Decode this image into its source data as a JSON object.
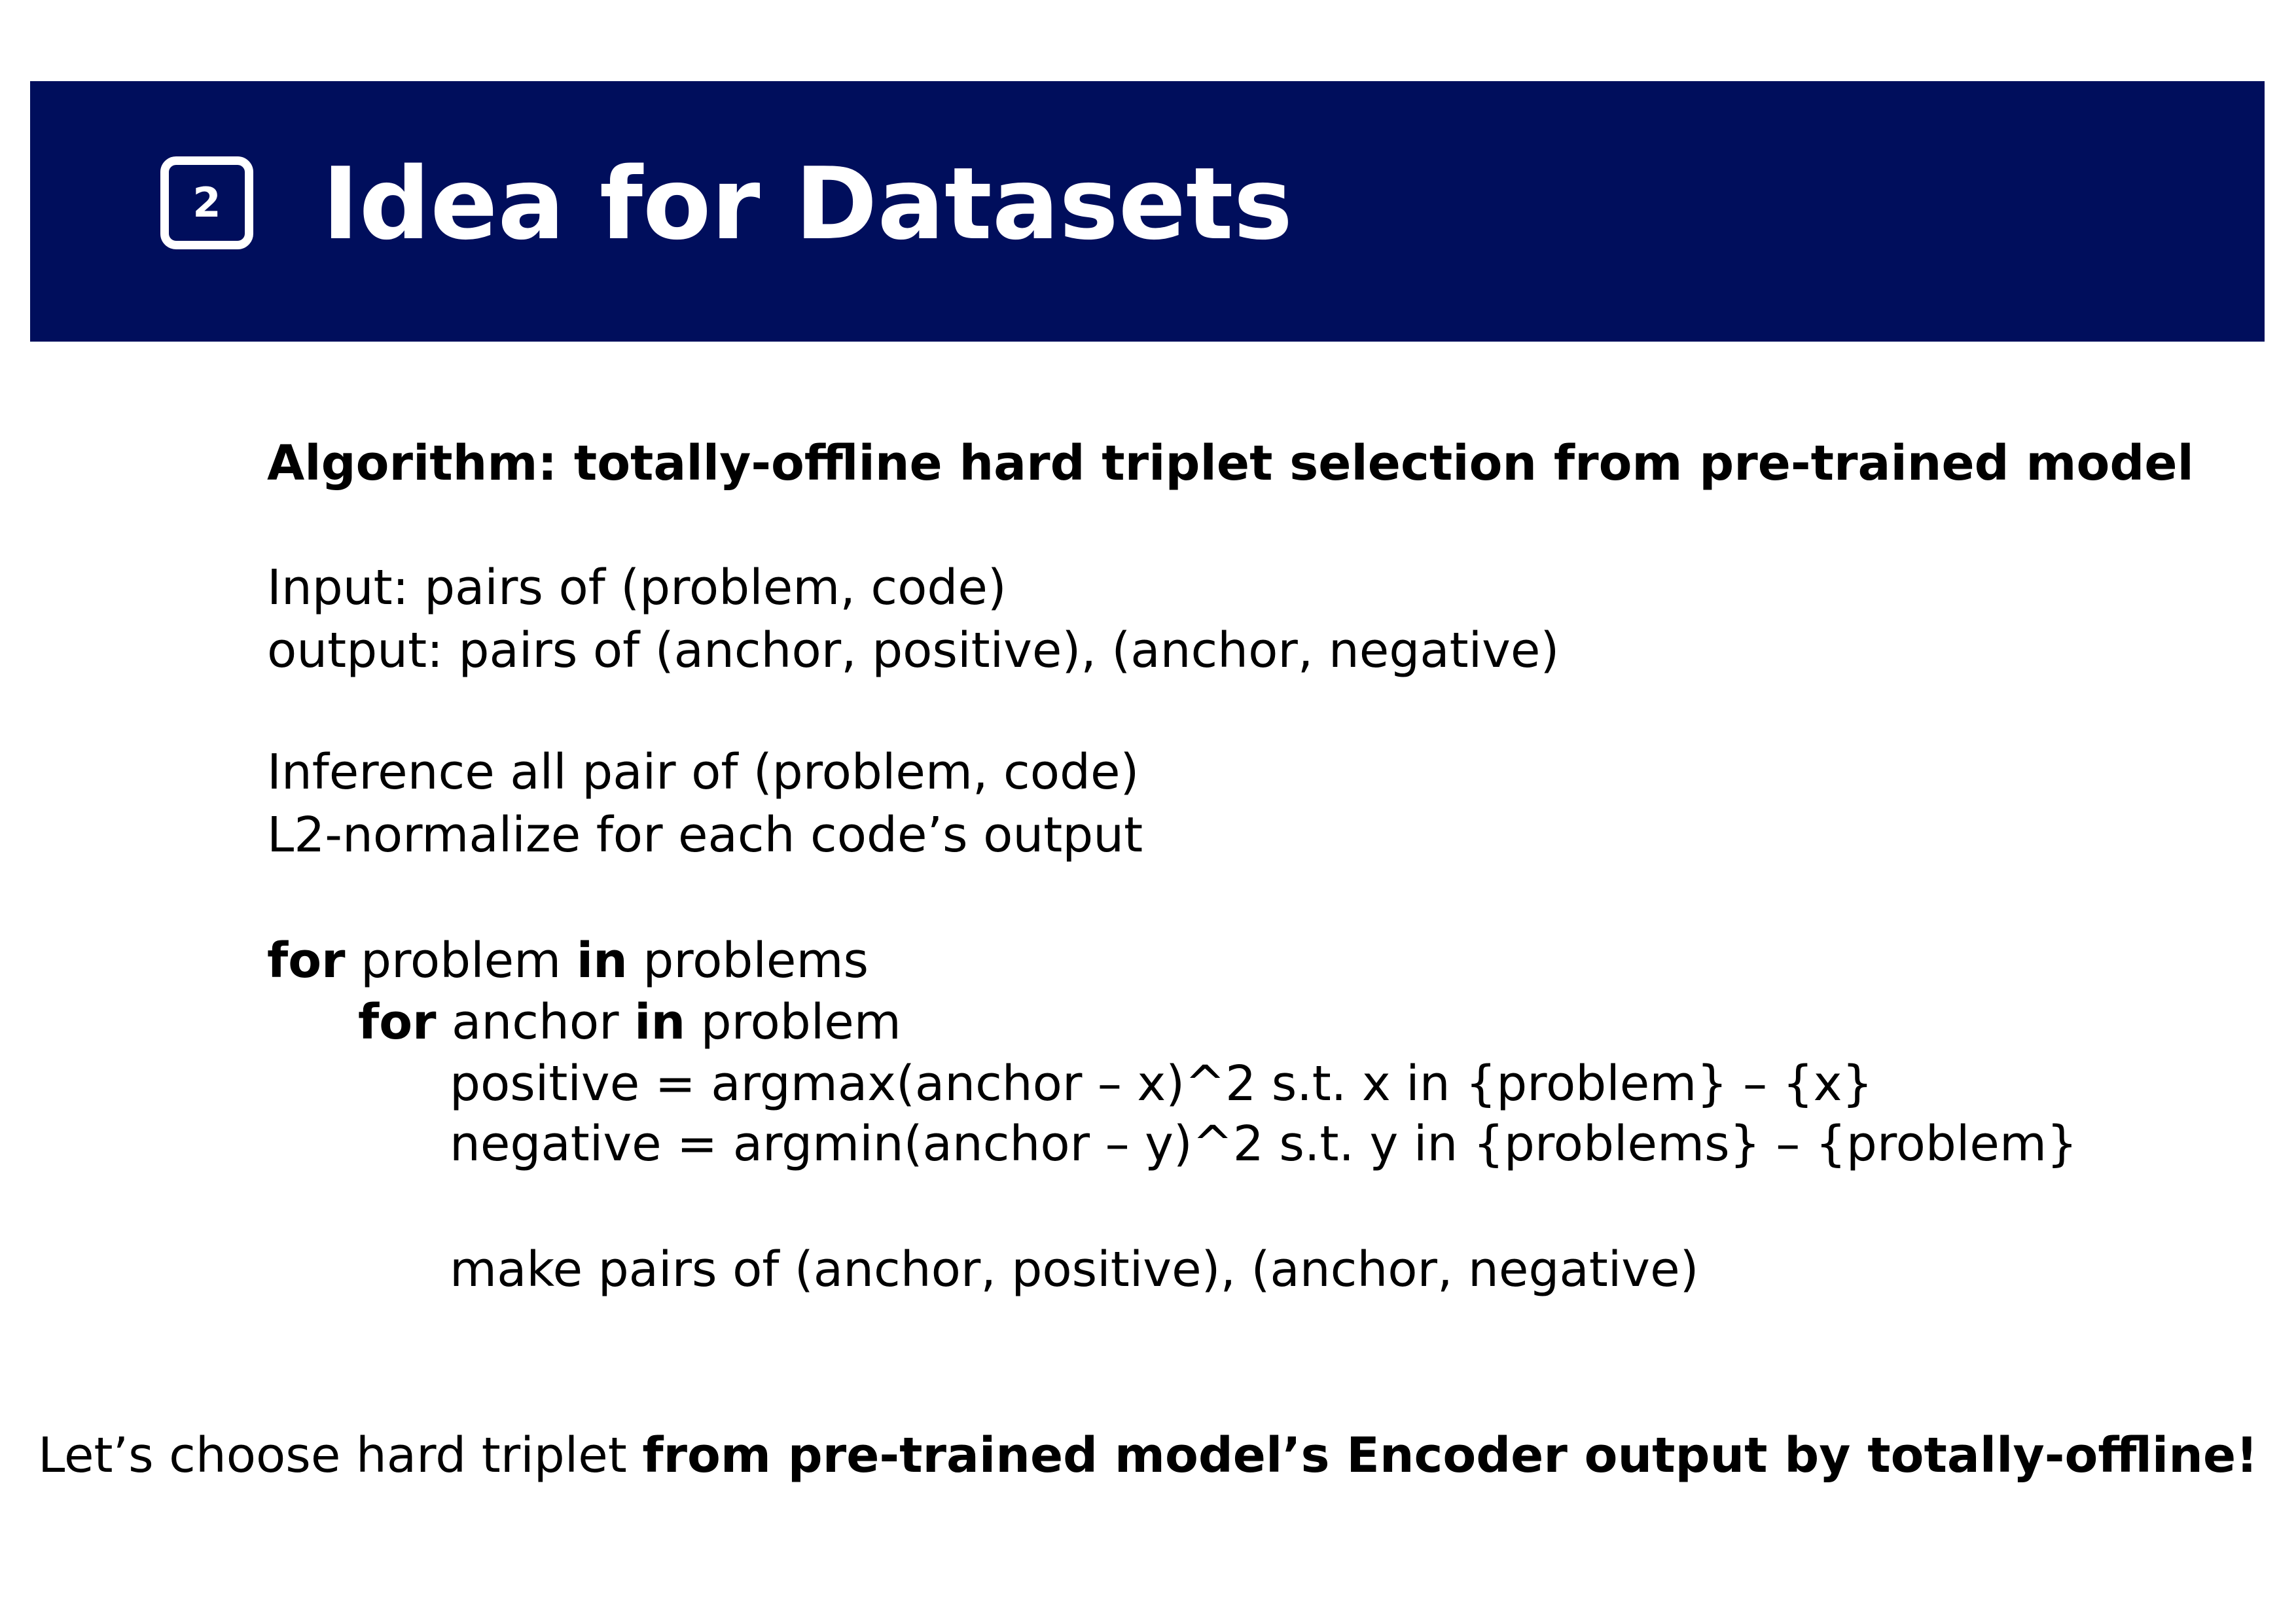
{
  "header": {
    "badge_number": "2",
    "title": "Idea for Datasets",
    "background_color": "#000e5c",
    "text_color": "#ffffff"
  },
  "algorithm": {
    "title": "Algorithm: totally-offline hard triplet selection from pre-trained model",
    "input": "Input: pairs of (problem, code)",
    "output": "output: pairs of (anchor, positive), (anchor, negative)",
    "step1": "Inference all pair of (problem, code)",
    "step2": "L2-normalize for each code’s output",
    "loop1": {
      "kw_for": "for",
      "var": " problem ",
      "kw_in": "in",
      "coll": " problems"
    },
    "loop2": {
      "kw_for": "for",
      "var": " anchor ",
      "kw_in": "in",
      "coll": " problem"
    },
    "positive_line": "positive = argmax(anchor – x)^2 s.t. x in {problem} – {x}",
    "negative_line": "negative = argmin(anchor – y)^2 s.t. y in {problems} – {problem}",
    "make_pairs": "make pairs of (anchor, positive), (anchor, negative)"
  },
  "footer": {
    "normal": "Let’s choose hard triplet ",
    "bold": "from pre-trained model’s Encoder output by totally-offline!"
  }
}
